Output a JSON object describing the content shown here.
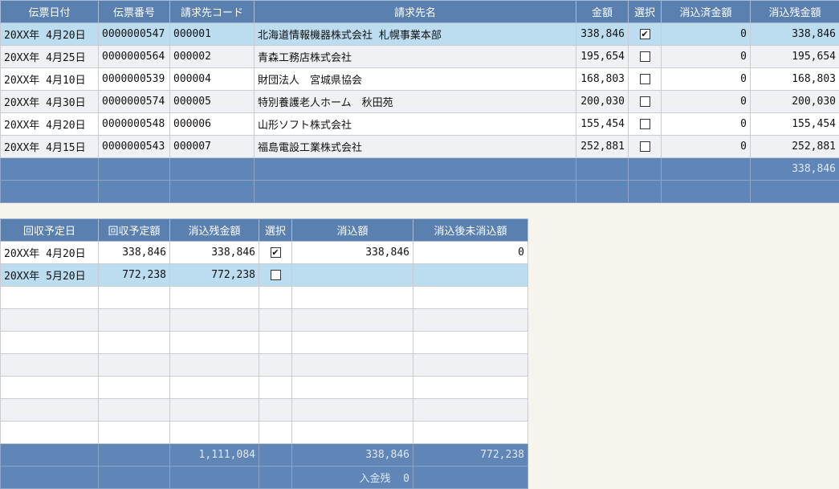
{
  "invoice_table": {
    "headers": {
      "date": "伝票日付",
      "slip_no": "伝票番号",
      "client_code": "請求先コード",
      "client_name": "請求先名",
      "amount": "金額",
      "select": "選択",
      "cleared": "消込済金額",
      "remaining": "消込残金額"
    },
    "rows": [
      {
        "date": "20XX年 4月20日",
        "slip_no": "0000000547",
        "client_code": "000001",
        "client_name": "北海道情報機器株式会社 札幌事業本部",
        "amount": "338,846",
        "checked": true,
        "cleared": "0",
        "remaining": "338,846"
      },
      {
        "date": "20XX年 4月25日",
        "slip_no": "0000000564",
        "client_code": "000002",
        "client_name": "青森工務店株式会社",
        "amount": "195,654",
        "checked": false,
        "cleared": "0",
        "remaining": "195,654"
      },
      {
        "date": "20XX年 4月10日",
        "slip_no": "0000000539",
        "client_code": "000004",
        "client_name": "財団法人　宮城県協会",
        "amount": "168,803",
        "checked": false,
        "cleared": "0",
        "remaining": "168,803"
      },
      {
        "date": "20XX年 4月30日",
        "slip_no": "0000000574",
        "client_code": "000005",
        "client_name": "特別養護老人ホーム　秋田苑",
        "amount": "200,030",
        "checked": false,
        "cleared": "0",
        "remaining": "200,030"
      },
      {
        "date": "20XX年 4月20日",
        "slip_no": "0000000548",
        "client_code": "000006",
        "client_name": "山形ソフト株式会社",
        "amount": "155,454",
        "checked": false,
        "cleared": "0",
        "remaining": "155,454"
      },
      {
        "date": "20XX年 4月15日",
        "slip_no": "0000000543",
        "client_code": "000007",
        "client_name": "福島電設工業株式会社",
        "amount": "252,881",
        "checked": false,
        "cleared": "0",
        "remaining": "252,881"
      }
    ],
    "footer_total_remaining": "338,846"
  },
  "schedule_table": {
    "headers": {
      "due_date": "回収予定日",
      "due_amount": "回収予定額",
      "remaining": "消込残金額",
      "select": "選択",
      "cleared": "消込額",
      "after": "消込後未消込額"
    },
    "rows": [
      {
        "due_date": "20XX年 4月20日",
        "due_amount": "338,846",
        "remaining": "338,846",
        "checked": true,
        "cleared": "338,846",
        "after": "0"
      },
      {
        "due_date": "20XX年 5月20日",
        "due_amount": "772,238",
        "remaining": "772,238",
        "checked": false,
        "cleared": "",
        "after": ""
      }
    ],
    "footer": {
      "total_remaining": "1,111,084",
      "total_cleared": "338,846",
      "total_after": "772,238",
      "deposit_label": "入金残",
      "deposit_value": "0"
    }
  },
  "colors": {
    "header_bg": "#5a80b0",
    "selected_row": "#bcdcf0",
    "footer_bg": "#5f86b6"
  }
}
